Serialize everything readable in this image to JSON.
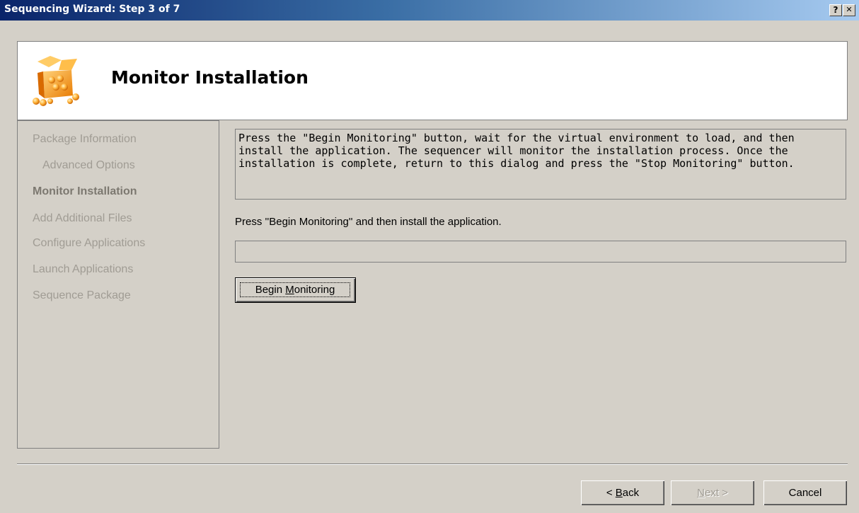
{
  "window": {
    "title": "Sequencing Wizard: Step 3 of 7",
    "help_button": "?",
    "close_button": "✕"
  },
  "header": {
    "title": "Monitor Installation",
    "icon": "package-box-icon"
  },
  "nav": {
    "items": [
      {
        "label": "Package Information",
        "state": "done"
      },
      {
        "label": "Advanced Options",
        "state": "done",
        "indent": true
      },
      {
        "label": "Monitor Installation",
        "state": "current"
      },
      {
        "label": "Add Additional Files",
        "state": "pending"
      },
      {
        "label": "Configure Applications",
        "state": "pending"
      },
      {
        "label": "Launch Applications",
        "state": "pending"
      },
      {
        "label": "Sequence Package",
        "state": "pending"
      }
    ]
  },
  "main": {
    "description": "Press the \"Begin Monitoring\" button, wait for the virtual environment to load, and then install the application.  The sequencer will monitor the installation process.  Once the installation is complete, return to this dialog and press the \"Stop Monitoring\" button.",
    "status_text": "Press ''Begin Monitoring'' and then install the application.",
    "progress": 0,
    "begin_button": {
      "before": "Begin ",
      "mnemonic": "M",
      "after": "onitoring"
    }
  },
  "footer": {
    "back": {
      "before": "< ",
      "mnemonic": "B",
      "after": "ack"
    },
    "next": {
      "before": "",
      "mnemonic": "N",
      "after": "ext >"
    },
    "cancel": "Cancel"
  },
  "colors": {
    "title_bar_start": "#0a246a",
    "title_bar_end": "#a6caf0",
    "dialog_bg": "#d4d0c8",
    "nav_text_inactive": "#a09c94",
    "nav_text_current": "#7c7870"
  }
}
